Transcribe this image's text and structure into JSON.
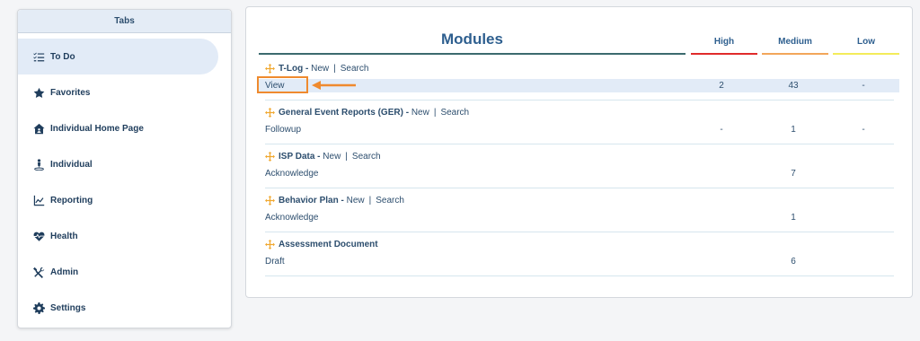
{
  "sidebar": {
    "header": "Tabs",
    "items": [
      {
        "label": "To Do",
        "icon": "todo-list-icon",
        "active": true
      },
      {
        "label": "Favorites",
        "icon": "star-icon"
      },
      {
        "label": "Individual Home Page",
        "icon": "home-icon"
      },
      {
        "label": "Individual",
        "icon": "person-icon"
      },
      {
        "label": "Reporting",
        "icon": "line-chart-icon"
      },
      {
        "label": "Health",
        "icon": "heart-pulse-icon"
      },
      {
        "label": "Admin",
        "icon": "tools-icon"
      },
      {
        "label": "Settings",
        "icon": "gear-icon"
      }
    ]
  },
  "main": {
    "title": "Modules",
    "columns": {
      "high": "High",
      "medium": "Medium",
      "low": "Low"
    },
    "colors": {
      "high": "#e02b2b",
      "medium": "#f2a65a",
      "low": "#f3ec5a",
      "accent": "#ef8a2e"
    },
    "sep": "|",
    "modules": [
      {
        "name": "T-Log -",
        "new": "New",
        "search": "Search",
        "row": {
          "label": "View",
          "high": "2",
          "medium": "43",
          "low": "-"
        }
      },
      {
        "name": "General Event Reports (GER) -",
        "new": "New",
        "search": "Search",
        "row": {
          "label": "Followup",
          "high": "-",
          "medium": "1",
          "low": "-"
        }
      },
      {
        "name": "ISP Data -",
        "new": "New",
        "search": "Search",
        "row": {
          "label": "Acknowledge",
          "high": "",
          "medium": "7",
          "low": ""
        }
      },
      {
        "name": "Behavior Plan -",
        "new": "New",
        "search": "Search",
        "row": {
          "label": "Acknowledge",
          "high": "",
          "medium": "1",
          "low": ""
        }
      },
      {
        "name": "Assessment Document",
        "row": {
          "label": "Draft",
          "high": "",
          "medium": "6",
          "low": ""
        }
      }
    ]
  }
}
